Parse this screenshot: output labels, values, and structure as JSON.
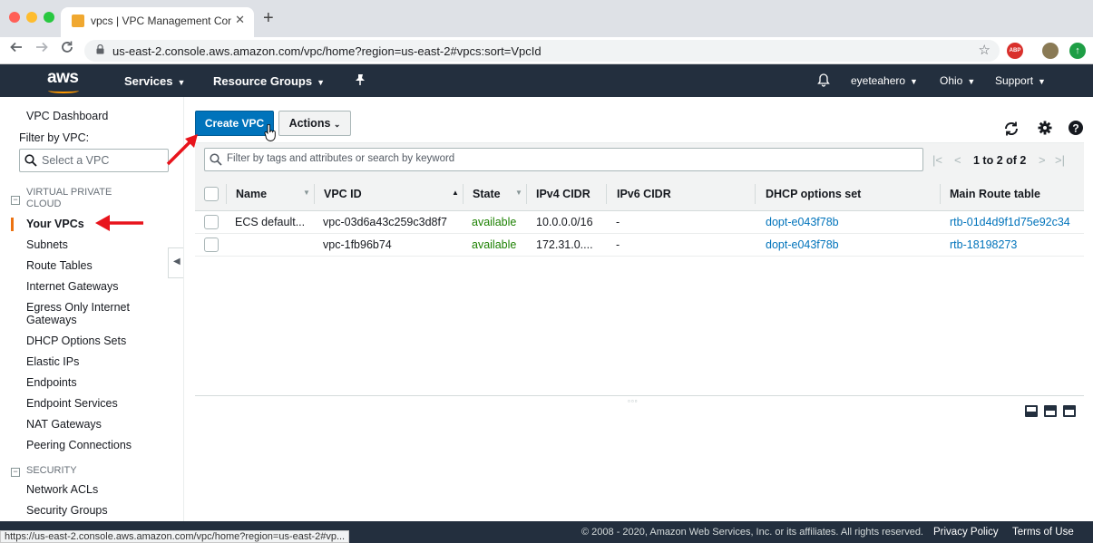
{
  "browser": {
    "tab_title": "vpcs | VPC Management Cons",
    "tab_close": "✕",
    "new_tab": "+",
    "url": "us-east-2.console.aws.amazon.com/vpc/home?region=us-east-2#vpcs:sort=VpcId",
    "extension_abp": "ABP",
    "status_url": "https://us-east-2.console.aws.amazon.com/vpc/home?region=us-east-2#vp..."
  },
  "aws_header": {
    "logo": "aws",
    "services": "Services",
    "resource_groups": "Resource Groups",
    "user": "eyeteahero",
    "region": "Ohio",
    "support": "Support"
  },
  "sidebar": {
    "dashboard": "VPC Dashboard",
    "filter_label": "Filter by VPC:",
    "filter_placeholder": "Select a VPC",
    "section_vpc": "VIRTUAL PRIVATE CLOUD",
    "items": [
      "Your VPCs",
      "Subnets",
      "Route Tables",
      "Internet Gateways",
      "Egress Only Internet Gateways",
      "DHCP Options Sets",
      "Elastic IPs",
      "Endpoints",
      "Endpoint Services",
      "NAT Gateways",
      "Peering Connections"
    ],
    "section_security": "SECURITY",
    "security_items": [
      "Network ACLs",
      "Security Groups"
    ]
  },
  "toolbar": {
    "create_label": "Create VPC",
    "actions_label": "Actions"
  },
  "table": {
    "search_placeholder": "Filter by tags and attributes or search by keyword",
    "pagination": "1 to 2 of 2",
    "columns": [
      "Name",
      "VPC ID",
      "State",
      "IPv4 CIDR",
      "IPv6 CIDR",
      "DHCP options set",
      "Main Route table"
    ],
    "rows": [
      {
        "name": "ECS default...",
        "vpc_id": "vpc-03d6a43c259c3d8f7",
        "state": "available",
        "ipv4": "10.0.0.0/16",
        "ipv6": "-",
        "dhcp": "dopt-e043f78b",
        "route": "rtb-01d4d9f1d75e92c34"
      },
      {
        "name": "",
        "vpc_id": "vpc-1fb96b74",
        "state": "available",
        "ipv4": "172.31.0....",
        "ipv6": "-",
        "dhcp": "dopt-e043f78b",
        "route": "rtb-18198273"
      }
    ]
  },
  "footer": {
    "copyright": "© 2008 - 2020, Amazon Web Services, Inc. or its affiliates. All rights reserved.",
    "privacy": "Privacy Policy",
    "terms": "Terms of Use"
  },
  "colors": {
    "aws_navy": "#232f3e",
    "aws_orange": "#ff9900",
    "primary_blue": "#0073bb",
    "available_green": "#1d8102",
    "annotation_red": "#e8141c"
  }
}
